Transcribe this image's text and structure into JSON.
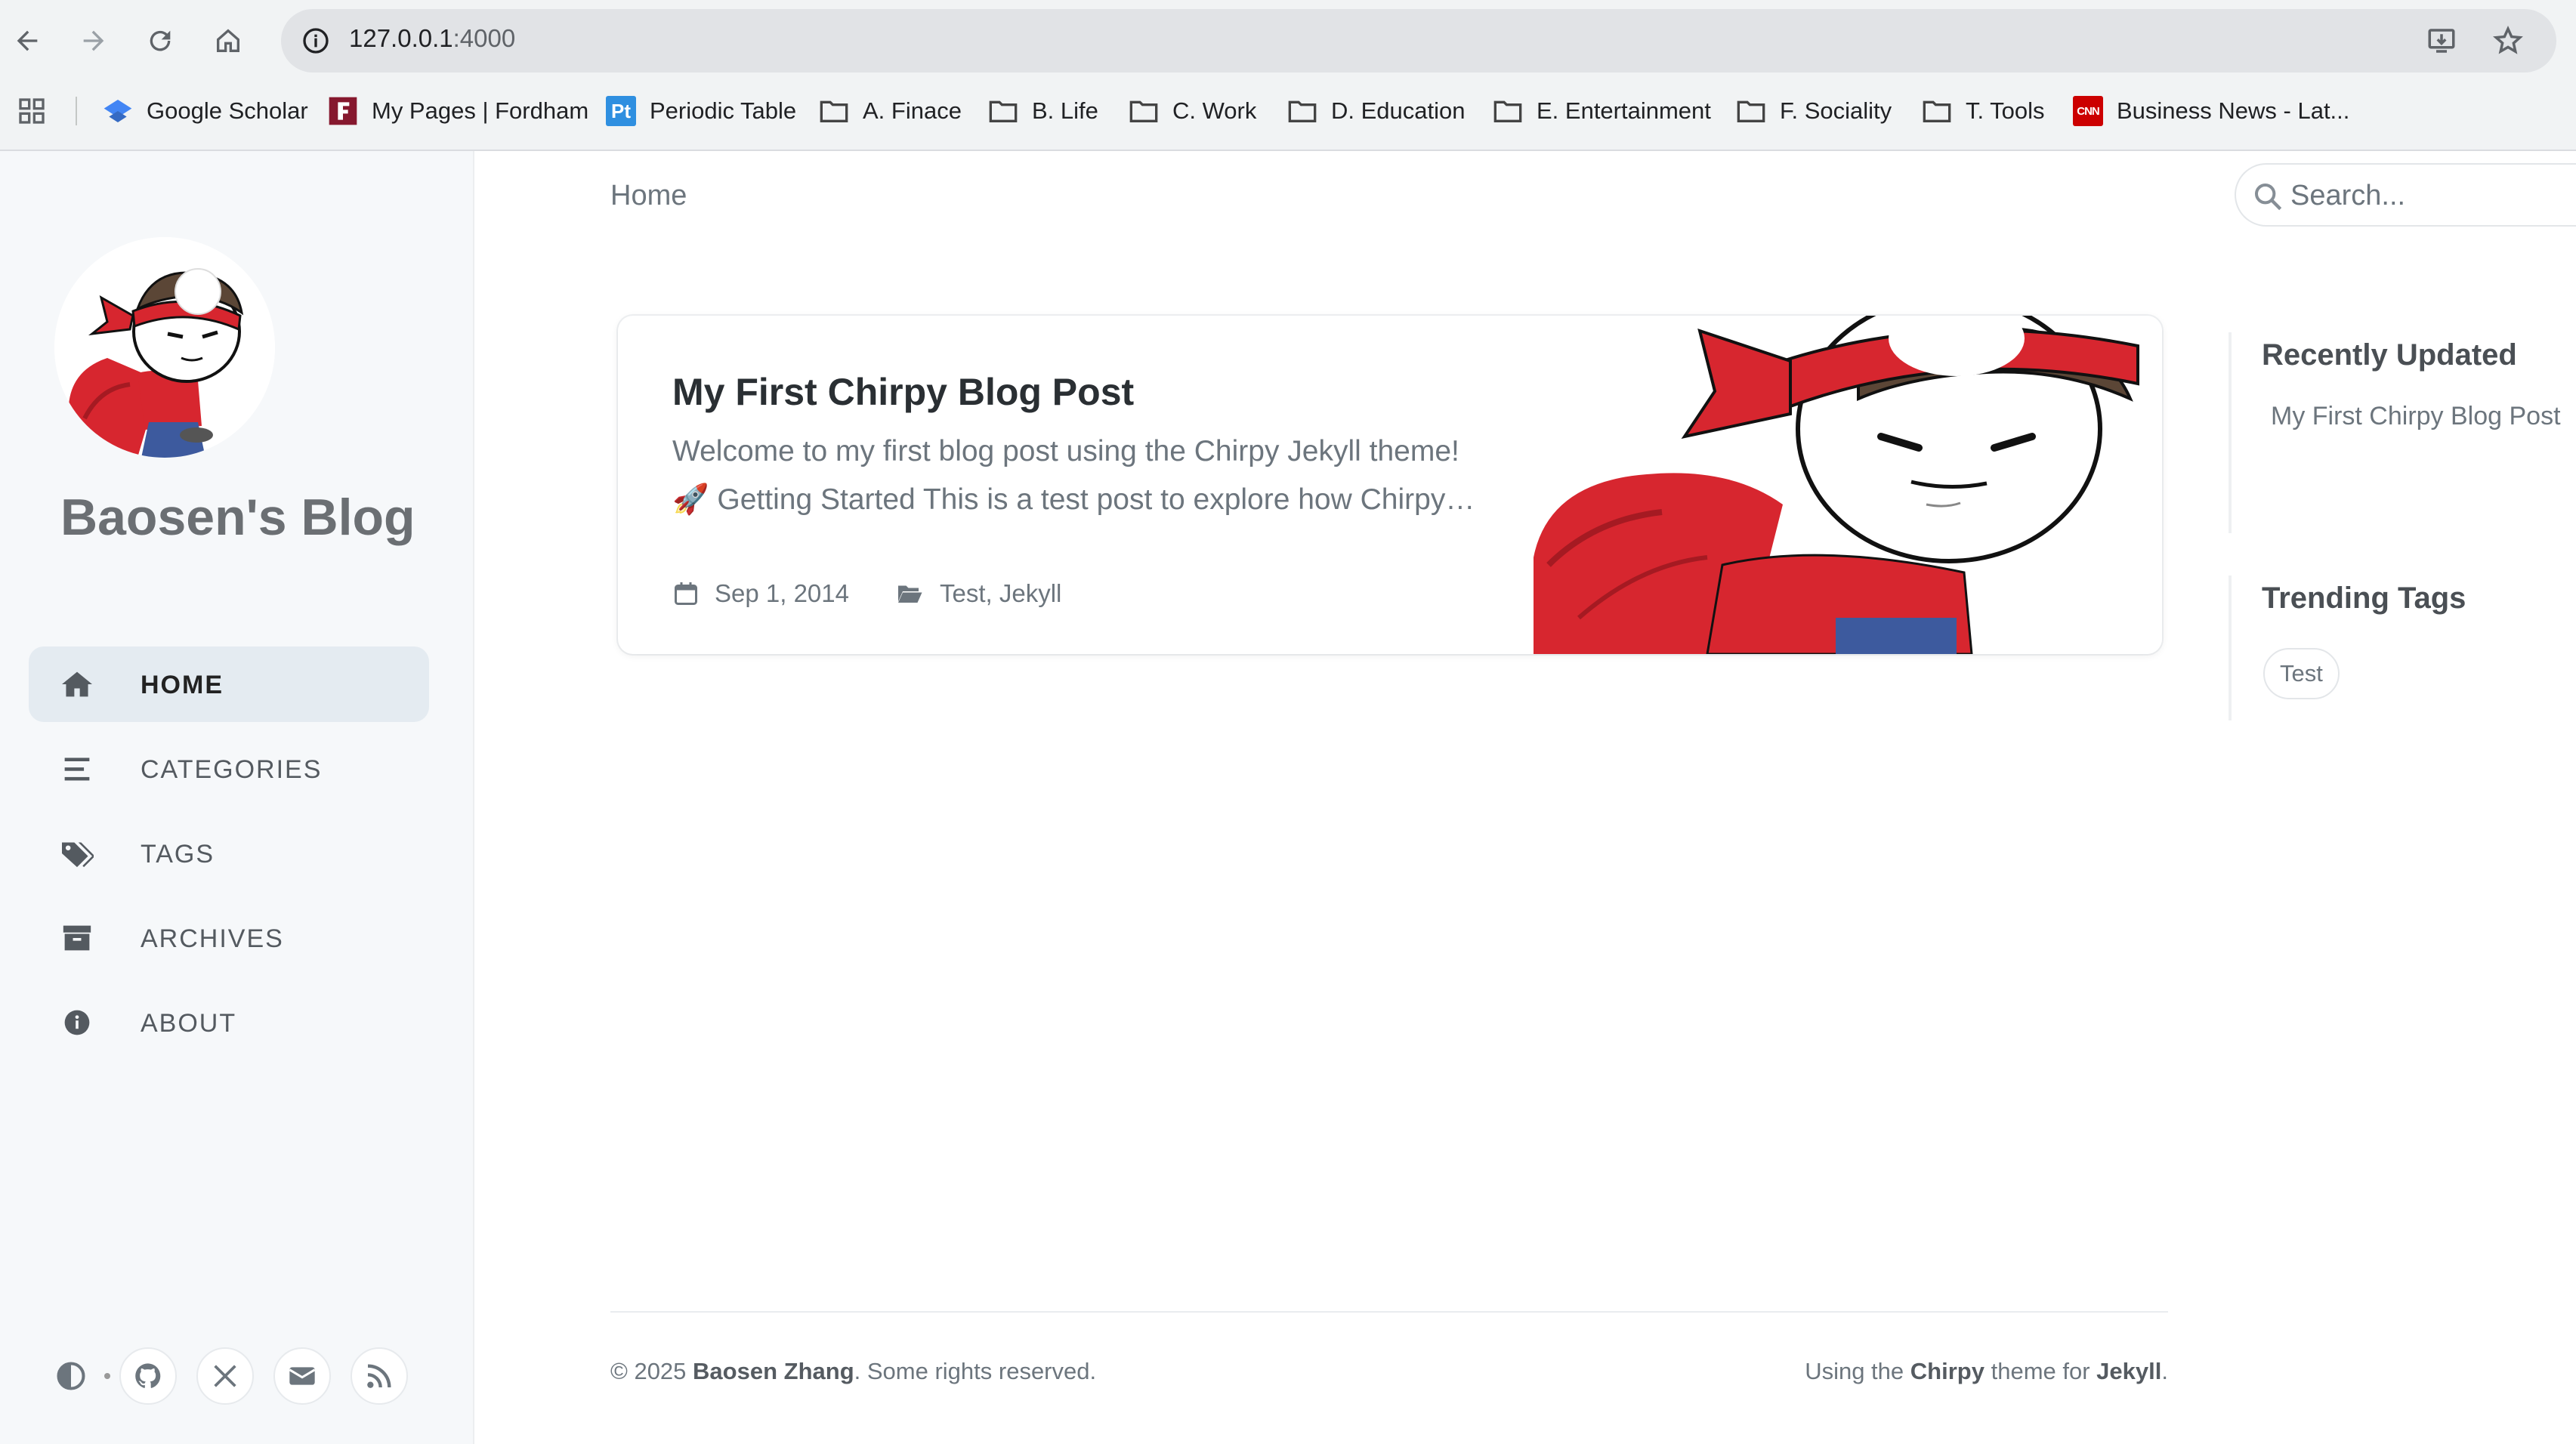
{
  "browser": {
    "url_host": "127.0.0.1",
    "url_port": ":4000",
    "bookmarks": [
      {
        "label": "Google Scholar",
        "icon": "google-scholar-icon"
      },
      {
        "label": "My Pages | Fordham",
        "icon": "fordham-icon"
      },
      {
        "label": "Periodic Table",
        "icon": "periodic-table-icon",
        "icon_text": "Pt"
      },
      {
        "label": "A. Finace",
        "icon": "folder-icon"
      },
      {
        "label": "B. Life",
        "icon": "folder-icon"
      },
      {
        "label": "C. Work",
        "icon": "folder-icon"
      },
      {
        "label": "D. Education",
        "icon": "folder-icon"
      },
      {
        "label": "E. Entertainment",
        "icon": "folder-icon"
      },
      {
        "label": "F. Sociality",
        "icon": "folder-icon"
      },
      {
        "label": "T. Tools",
        "icon": "folder-icon"
      },
      {
        "label": "Business News - Lat...",
        "icon": "cnn-icon",
        "icon_text": "CNN"
      }
    ]
  },
  "sidebar": {
    "site_title": "Baosen's Blog",
    "nav": [
      {
        "label": "HOME",
        "icon": "home-icon",
        "active": true
      },
      {
        "label": "CATEGORIES",
        "icon": "stream-icon"
      },
      {
        "label": "TAGS",
        "icon": "tags-icon"
      },
      {
        "label": "ARCHIVES",
        "icon": "archive-icon"
      },
      {
        "label": "ABOUT",
        "icon": "info-circle-icon"
      }
    ],
    "bottom_icons": [
      "mode-toggle-icon",
      "github-icon",
      "x-twitter-icon",
      "envelope-icon",
      "rss-icon"
    ]
  },
  "topbar": {
    "breadcrumb": "Home",
    "search_placeholder": "Search..."
  },
  "post": {
    "title": "My First Chirpy Blog Post",
    "excerpt_line1": "Welcome to my first blog post using the Chirpy Jekyll theme!",
    "excerpt_line2": "Getting Started This is a test post to explore how Chirpy…",
    "excerpt_emoji": "🚀",
    "date": "Sep 1, 2014",
    "categories": "Test, Jekyll"
  },
  "panels": {
    "recently_updated_title": "Recently Updated",
    "recently_updated_item": "My First Chirpy Blog Post",
    "trending_tags_title": "Trending Tags",
    "trending_tag": "Test"
  },
  "footer": {
    "copyright_prefix": "© 2025",
    "author": "Baosen Zhang",
    "rights": ". Some rights reserved.",
    "using_the": "Using the",
    "theme": "Chirpy",
    "theme_for": "theme for",
    "engine": "Jekyll",
    "period": "."
  },
  "colors": {
    "accent_red": "#d7262f",
    "sidebar_bg": "#f6f8fa",
    "active_nav_bg": "#e4ebf1"
  }
}
